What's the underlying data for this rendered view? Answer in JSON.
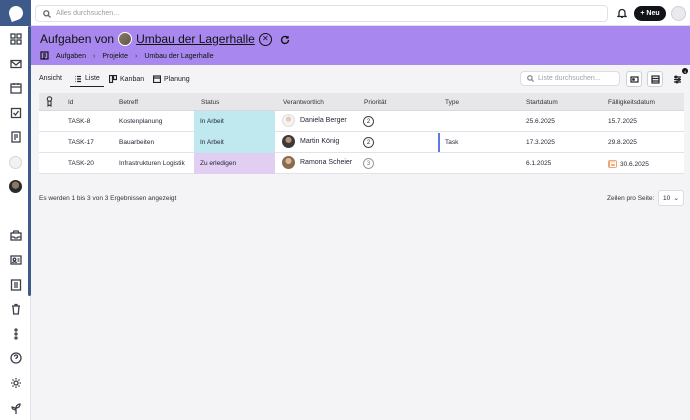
{
  "topbar": {
    "search_placeholder": "Alles durchsuchen...",
    "new_label": "Neu"
  },
  "header": {
    "title_prefix": "Aufgaben von",
    "project_name": "Umbau der Lagerhalle",
    "breadcrumbs": [
      "Aufgaben",
      "Projekte",
      "Umbau der Lagerhalle"
    ]
  },
  "viewbar": {
    "label": "Ansicht",
    "tabs": [
      {
        "label": "Liste",
        "icon": "list-icon",
        "active": true
      },
      {
        "label": "Kanban",
        "icon": "kanban-icon",
        "active": false
      },
      {
        "label": "Planung",
        "icon": "calendar-icon",
        "active": false
      }
    ],
    "search_placeholder": "Liste durchsuchen...",
    "filter_badge": "4"
  },
  "table": {
    "columns": [
      "Id",
      "Betreff",
      "Status",
      "Verantwortlich",
      "Priorität",
      "Type",
      "Startdatum",
      "Fälligkeitsdatum"
    ],
    "rows": [
      {
        "id": "TASK-8",
        "subject": "Kostenplanung",
        "status": "In Arbeit",
        "status_color": "#bfe8ef",
        "owner": "Daniela Berger",
        "priority": "2",
        "type": "",
        "start": "25.6.2025",
        "due": "15.7.2025",
        "due_flag": false
      },
      {
        "id": "TASK-17",
        "subject": "Bauarbeiten",
        "status": "In Arbeit",
        "status_color": "#bfe8ef",
        "owner": "Martin König",
        "priority": "2",
        "type": "Task",
        "start": "17.3.2025",
        "due": "29.8.2025",
        "due_flag": false
      },
      {
        "id": "TASK-20",
        "subject": "Infrastrukturen Logistik",
        "status": "Zu erledigen",
        "status_color": "#e2cdf3",
        "owner": "Ramona Scheier",
        "priority": "3",
        "type": "",
        "start": "6.1.2025",
        "due": "30.6.2025",
        "due_flag": true
      }
    ]
  },
  "footer": {
    "results_text": "Es werden 1 bis 3 von 3 Ergebnissen angezeigt",
    "per_page_label": "Zeilen pro Seite:",
    "per_page_value": "10"
  },
  "colors": {
    "header_bg": "#a888ee",
    "brand": "#3d5a8a",
    "priority_flag": "#f0a477"
  }
}
